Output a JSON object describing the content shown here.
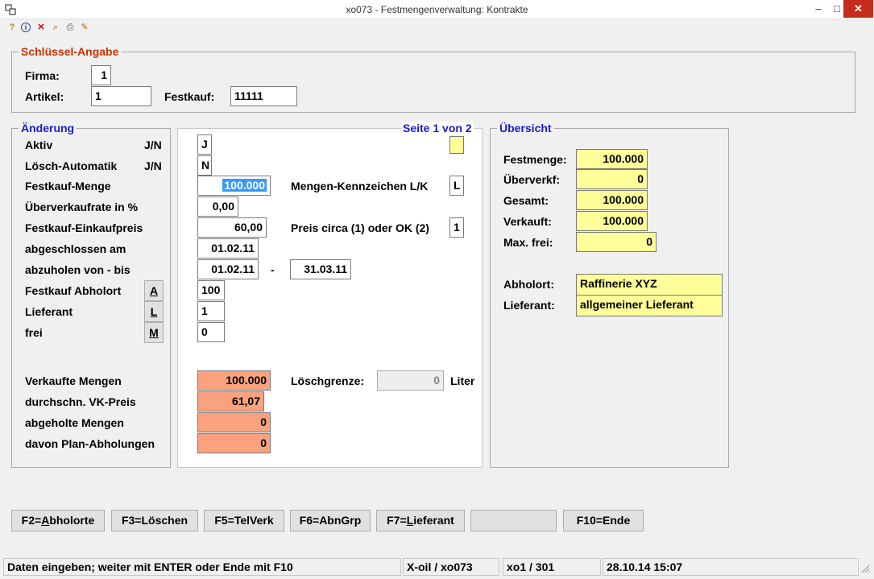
{
  "window": {
    "title": "xo073 - Festmengenverwaltung: Kontrakte",
    "min": "–",
    "max": "□",
    "close": "✕"
  },
  "toolbar": {
    "help": "?",
    "info": "i",
    "delete": "✕",
    "search": "⌕",
    "print": "⎙",
    "export": "✎"
  },
  "keys": {
    "legend": "Schlüssel-Angabe",
    "firma_label": "Firma:",
    "firma": "1",
    "artikel_label": "Artikel:",
    "artikel": "1",
    "festkauf_label": "Festkauf:",
    "festkauf": "11111"
  },
  "change": {
    "legend": "Änderung",
    "aktiv_label": "Aktiv",
    "aktiv_hint": "J/N",
    "loesch_label": "Lösch-Automatik",
    "loesch_hint": "J/N",
    "festkauf_menge_label": "Festkauf-Menge",
    "ueberverkauf_label": "Überverkaufrate in %",
    "einkaufpreis_label": "Festkauf-Einkaufpreis",
    "abgeschlossen_label": "abgeschlossen am",
    "abzuholen_label": "abzuholen von - bis",
    "abholort_label": "Festkauf Abholort",
    "abholort_btn": "A",
    "lieferant_label": "Lieferant",
    "lieferant_btn": "L",
    "frei_label": "frei",
    "frei_btn": "M",
    "verkaufte_label": "Verkaufte Mengen",
    "vk_preis_label": "durchschn. VK-Preis",
    "abgeholte_label": "abgeholte Mengen",
    "plan_label": "davon Plan-Abholungen"
  },
  "detail": {
    "page": "Seite 1 von 2",
    "aktiv": "J",
    "loesch": "N",
    "festkauf_menge": "100.000",
    "ueberverkauf": "0,00",
    "einkaufpreis": "60,00",
    "abgeschlossen": "01.02.11",
    "von": "01.02.11",
    "dash": "-",
    "bis": "31.03.11",
    "abholort": "100",
    "lieferant": "1",
    "frei": "0",
    "mengen_kz_label": "Mengen-Kennzeichen L/K",
    "mengen_kz": "L",
    "preis_label": "Preis circa (1) oder OK (2)",
    "preis": "1",
    "verkaufte": "100.000",
    "vk_preis": "61,07",
    "abgeholte": "0",
    "plan": "0",
    "loeschgrenze_label": "Löschgrenze:",
    "loeschgrenze": "0",
    "liter": "Liter"
  },
  "overview": {
    "legend": "Übersicht",
    "festmenge_label": "Festmenge:",
    "festmenge": "100.000",
    "ueberverkf_label": "Überverkf:",
    "ueberverkf": "0",
    "gesamt_label": "Gesamt:",
    "gesamt": "100.000",
    "verkauft_label": "Verkauft:",
    "verkauft": "100.000",
    "maxfrei_label": "Max. frei:",
    "maxfrei": "0",
    "abholort_label": "Abholort:",
    "abholort": "Raffinerie XYZ",
    "lieferant_label": "Lieferant:",
    "lieferant": "allgemeiner Lieferant"
  },
  "fkeys": {
    "f2_pre": "F2=",
    "f2_u": "A",
    "f2_post": "bholorte",
    "f3": "F3=Löschen",
    "f5": "F5=TelVerk",
    "f6": "F6=AbnGrp",
    "f7_pre": "F7=",
    "f7_u": "L",
    "f7_post": "ieferant",
    "f10": "F10=Ende"
  },
  "status": {
    "message": "Daten eingeben; weiter mit ENTER oder Ende mit F10",
    "program": "X-oil / xo073",
    "user": "xo1 / 301",
    "datetime": "28.10.14 15:07"
  },
  "colors": {
    "legend_red": "#cc3300",
    "legend_blue": "#1a1acc",
    "yellow_field": "#ffff99",
    "salmon_field": "#f9a27d"
  }
}
